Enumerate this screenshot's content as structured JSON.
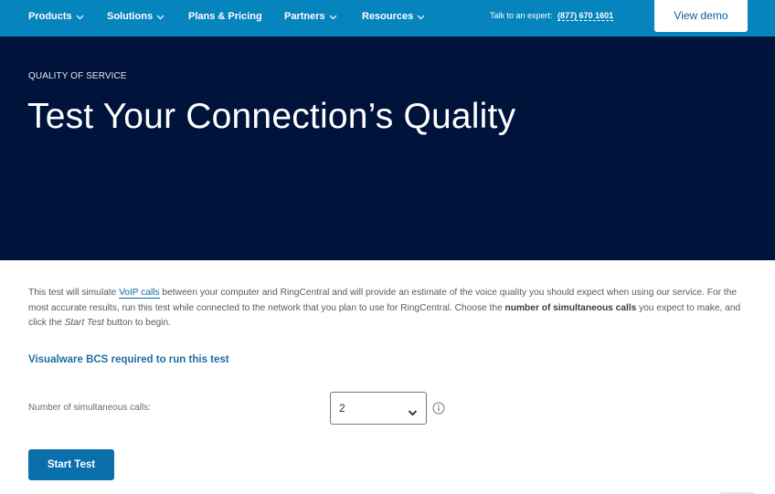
{
  "nav": {
    "items": [
      {
        "label": "Products",
        "has_dropdown": true
      },
      {
        "label": "Solutions",
        "has_dropdown": true
      },
      {
        "label": "Plans & Pricing",
        "has_dropdown": false
      },
      {
        "label": "Partners",
        "has_dropdown": true
      },
      {
        "label": "Resources",
        "has_dropdown": true
      }
    ],
    "expert_label": "Talk to an expert:",
    "expert_phone": "(877) 670 1601",
    "view_demo_label": "View demo",
    "bg_color": "#0684bd"
  },
  "hero": {
    "eyebrow": "QUALITY OF SERVICE",
    "title": "Test Your Connection’s Quality",
    "bg_color": "#00133b"
  },
  "intro": {
    "part1": "This test will simulate ",
    "link": "VoIP calls",
    "part2": " between your computer and RingCentral and will provide an estimate of the voice quality you should expect when using our service. For the most accurate results, run this test while connected to the network that you plan to use for RingCentral. Choose the ",
    "bold": "number of simultaneous calls",
    "part3": " you expect to make, and click the ",
    "italic": "Start Test",
    "part4": " button to begin."
  },
  "requirement": "Visualware BCS required to run this test",
  "calls": {
    "label": "Number of simultaneous calls:",
    "selected": "2"
  },
  "start_button": "Start Test"
}
